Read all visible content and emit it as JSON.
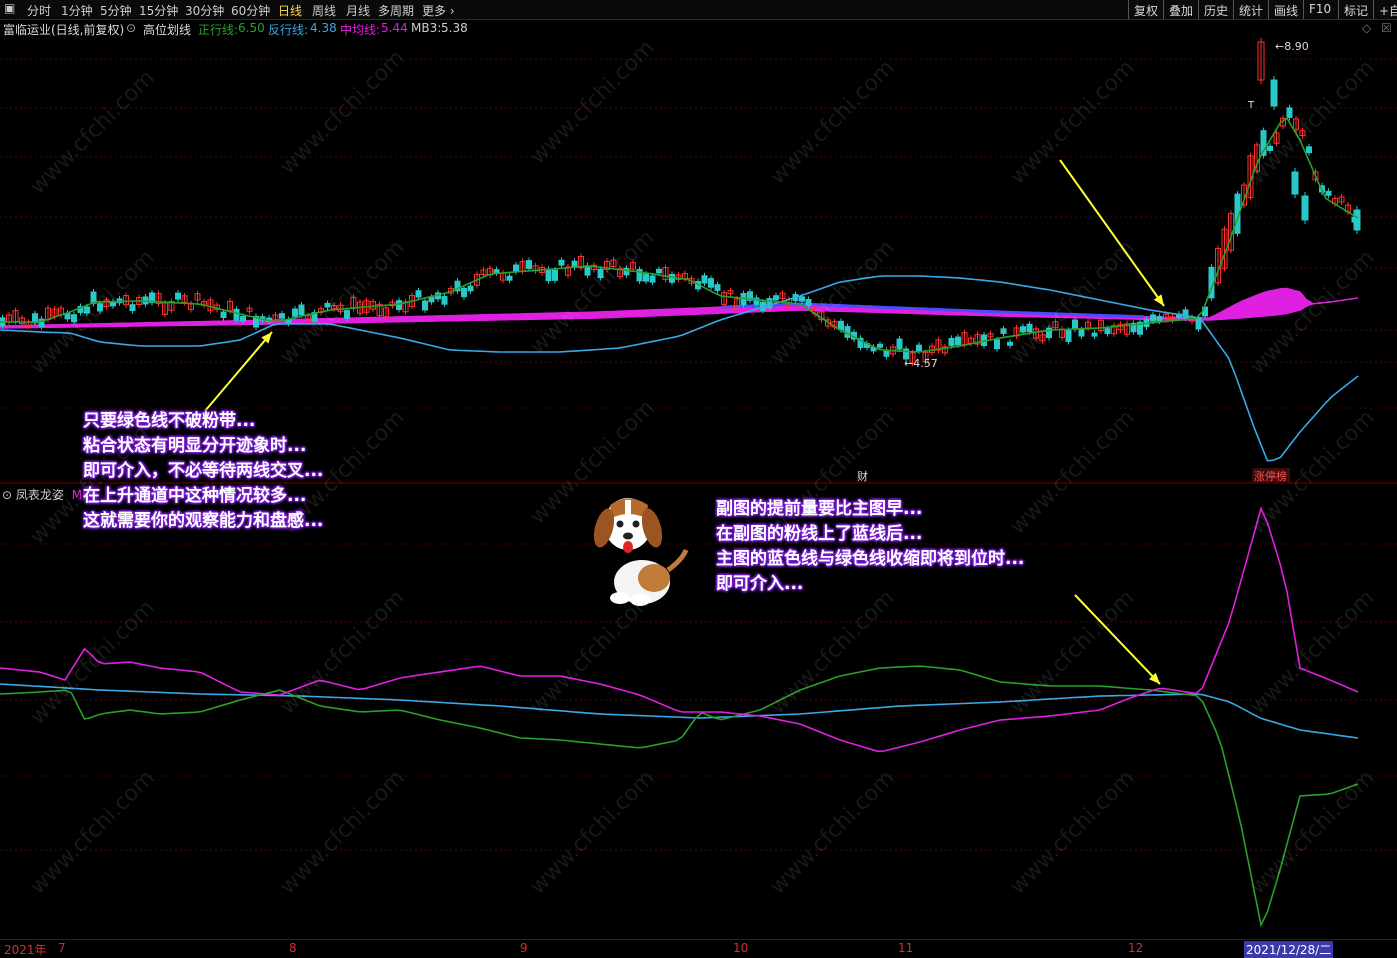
{
  "toolbar": {
    "periods": [
      "分时",
      "1分钟",
      "5分钟",
      "15分钟",
      "30分钟",
      "60分钟",
      "日线",
      "周线",
      "月线",
      "多周期",
      "更多"
    ],
    "active_period": "日线",
    "right_buttons": [
      "复权",
      "叠加",
      "历史",
      "统计",
      "画线",
      "F10",
      "标记",
      "+自"
    ]
  },
  "info": {
    "stock": "富临运业(日线,前复权)",
    "indicator": "高位划线",
    "zhengxing_label": "正行线:",
    "zhengxing_value": "6.50",
    "fanxing_label": "反行线:",
    "fanxing_value": "4.38",
    "zhongjun_label": "中均线:",
    "zhongjun_value": "5.44",
    "mb3_label": "MB3:",
    "mb3_value": "5.38"
  },
  "price_labels": {
    "high": "8.90",
    "low": "4.57"
  },
  "markers": {
    "cai": "财",
    "zhangting": "涨停榜",
    "t_mark": "T"
  },
  "sub_chart": {
    "title": "凤表龙姿",
    "sub_tag": "MI"
  },
  "notes_left": [
    "只要绿色线不破粉带...",
    "粘合状态有明显分开迹象时...",
    "即可介入，不必等待两线交叉...",
    "在上升通道中这种情况较多...",
    "这就需要你的观察能力和盘感..."
  ],
  "notes_right": [
    "副图的提前量要比主图早...",
    "在副图的粉线上了蓝线后...",
    "主图的蓝色线与绿色线收缩即将到位时...",
    "即可介入..."
  ],
  "dates": {
    "year": "2021年",
    "months": [
      "7",
      "8",
      "9",
      "10",
      "11",
      "12"
    ],
    "current": "2021/12/28/二"
  },
  "watermark": "www.cfchi.com",
  "colors": {
    "zhengxing": "#2aa02a",
    "fanxing": "#39a8e8",
    "zhongjun": "#e020e0",
    "up_candle": "#ff3030",
    "down_candle": "#28c8c8",
    "arrow": "#ffff33",
    "note_glow": "#7b1fd6"
  }
}
